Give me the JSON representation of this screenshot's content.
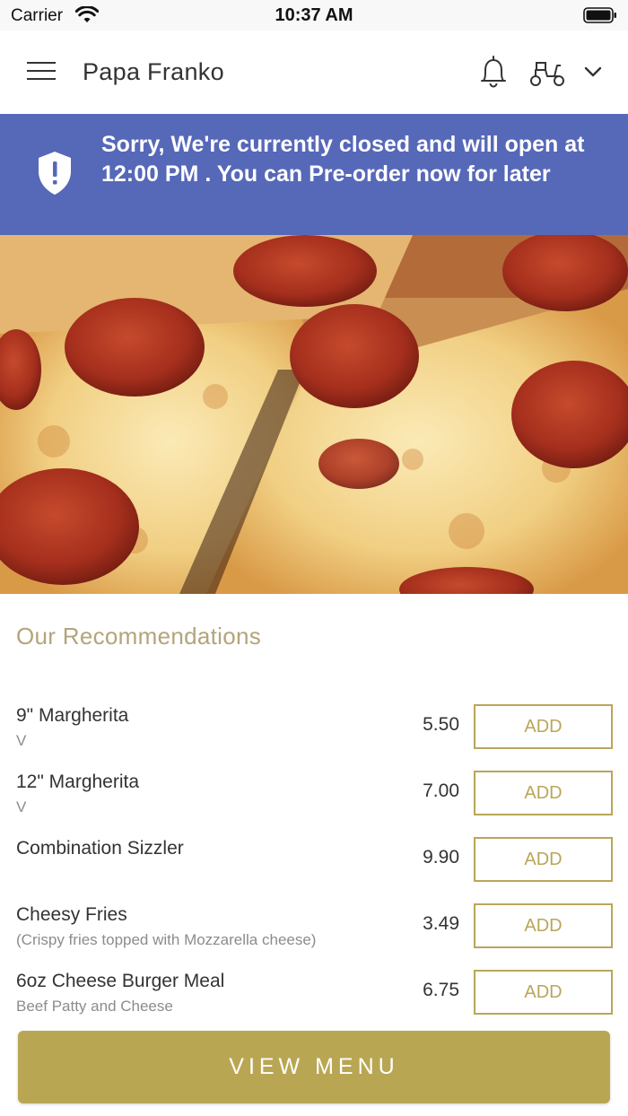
{
  "status_bar": {
    "carrier": "Carrier",
    "time": "10:37 AM"
  },
  "header": {
    "title": "Papa Franko",
    "icons": [
      "menu-icon",
      "bell-icon",
      "scooter-icon",
      "chevron-down-icon"
    ]
  },
  "banner": {
    "message": "Sorry, We're currently closed and will open at 12:00 PM . You can Pre-order now for later",
    "background": "#5668b8",
    "icon": "shield-alert-icon"
  },
  "recommendations": {
    "title": "Our Recommendations",
    "items": [
      {
        "name": "9\" Margherita",
        "description": "V",
        "price": "5.50",
        "button": "ADD"
      },
      {
        "name": "12\" Margherita",
        "description": "V",
        "price": "7.00",
        "button": "ADD"
      },
      {
        "name": "Combination Sizzler",
        "description": "",
        "price": "9.90",
        "button": "ADD"
      },
      {
        "name": "Cheesy Fries",
        "description": "(Crispy fries topped with Mozzarella cheese)",
        "price": "3.49",
        "button": "ADD"
      },
      {
        "name": "6oz Cheese Burger Meal",
        "description": "Beef Patty and Cheese",
        "price": "6.75",
        "button": "ADD"
      }
    ]
  },
  "footer": {
    "view_menu_label": "VIEW MENU",
    "accent": "#b9a653"
  }
}
